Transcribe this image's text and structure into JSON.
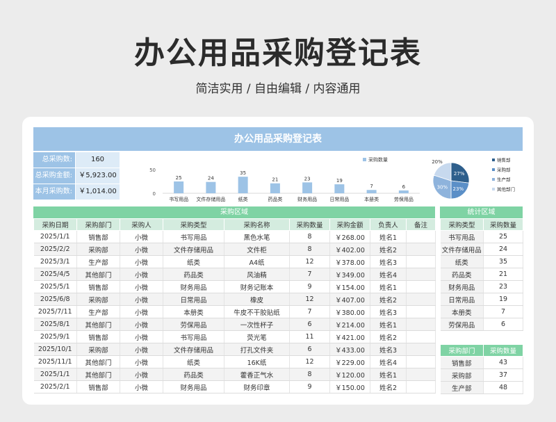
{
  "hero": {
    "title": "办公用品采购登记表",
    "subtitle": "简洁实用 / 自由编辑 / 内容通用"
  },
  "sheet": {
    "title": "办公用品采购登记表"
  },
  "kpis": [
    {
      "label": "总采购数:",
      "value": "160"
    },
    {
      "label": "总采购金额:",
      "value": "￥5,923.00"
    },
    {
      "label": "本月采购数:",
      "value": "￥1,014.00"
    }
  ],
  "chart_data": [
    {
      "type": "bar",
      "categories": [
        "书写用品",
        "文件存储用品",
        "纸类",
        "药品类",
        "财务用品",
        "日常用品",
        "本册类",
        "劳保用品"
      ],
      "values": [
        25,
        24,
        35,
        21,
        23,
        19,
        7,
        6
      ],
      "ylim": [
        0,
        50
      ],
      "yticks": [
        "50",
        "0"
      ],
      "legend": "采购数量",
      "legend_position": "top-right",
      "color": "#9dc3e6"
    },
    {
      "type": "pie",
      "categories": [
        "销售部",
        "采购部",
        "生产部",
        "其他部门"
      ],
      "values": [
        27,
        23,
        30,
        20
      ],
      "labels": [
        "27%",
        "23%",
        "30%",
        "20%"
      ],
      "colors": [
        "#2e5f8c",
        "#5b8fc7",
        "#8eb3dc",
        "#c7d9ee"
      ],
      "legend_position": "right"
    }
  ],
  "purchase": {
    "section_title": "采购区域",
    "headers": [
      "采购日期",
      "采购部门",
      "采购人",
      "采购类型",
      "采购名称",
      "采购数量",
      "采购金额",
      "负责人",
      "备注"
    ],
    "rows": [
      [
        "2025/1/1",
        "销售部",
        "小微",
        "书写用品",
        "黑色水笔",
        "8",
        "￥268.00",
        "姓名1",
        ""
      ],
      [
        "2025/2/2",
        "采购部",
        "小微",
        "文件存储用品",
        "文件柜",
        "8",
        "￥402.00",
        "姓名2",
        ""
      ],
      [
        "2025/3/1",
        "生产部",
        "小微",
        "纸类",
        "A4纸",
        "12",
        "￥378.00",
        "姓名3",
        ""
      ],
      [
        "2025/4/5",
        "其他部门",
        "小微",
        "药品类",
        "风油精",
        "7",
        "￥349.00",
        "姓名4",
        ""
      ],
      [
        "2025/5/1",
        "销售部",
        "小微",
        "财务用品",
        "财务记账本",
        "9",
        "￥154.00",
        "姓名1",
        ""
      ],
      [
        "2025/6/8",
        "采购部",
        "小微",
        "日常用品",
        "橡皮",
        "12",
        "￥407.00",
        "姓名2",
        ""
      ],
      [
        "2025/7/11",
        "生产部",
        "小微",
        "本册类",
        "牛皮不干胶贴纸",
        "7",
        "￥380.00",
        "姓名3",
        ""
      ],
      [
        "2025/8/1",
        "其他部门",
        "小微",
        "劳保用品",
        "一次性杯子",
        "6",
        "￥214.00",
        "姓名1",
        ""
      ],
      [
        "2025/9/1",
        "销售部",
        "小微",
        "书写用品",
        "荧光笔",
        "11",
        "￥421.00",
        "姓名2",
        ""
      ],
      [
        "2025/10/1",
        "采购部",
        "小微",
        "文件存储用品",
        "打孔文件夹",
        "6",
        "￥433.00",
        "姓名3",
        ""
      ],
      [
        "2025/11/1",
        "其他部门",
        "小微",
        "纸类",
        "16K纸",
        "12",
        "￥229.00",
        "姓名4",
        ""
      ],
      [
        "2025/1/1",
        "其他部门",
        "小微",
        "药品类",
        "藿香正气水",
        "8",
        "￥120.00",
        "姓名1",
        ""
      ],
      [
        "2025/2/1",
        "销售部",
        "小微",
        "财务用品",
        "财务印章",
        "9",
        "￥150.00",
        "姓名2",
        ""
      ]
    ]
  },
  "stats": {
    "section_title": "统计区域",
    "type_headers": [
      "采购类型",
      "采购数量"
    ],
    "type_rows": [
      [
        "书写用品",
        "25"
      ],
      [
        "文件存储用品",
        "24"
      ],
      [
        "纸类",
        "35"
      ],
      [
        "药品类",
        "21"
      ],
      [
        "财务用品",
        "23"
      ],
      [
        "日常用品",
        "19"
      ],
      [
        "本册类",
        "7"
      ],
      [
        "劳保用品",
        "6"
      ]
    ],
    "dept_headers": [
      "采购部门",
      "采购数量"
    ],
    "dept_rows": [
      [
        "销售部",
        "43"
      ],
      [
        "采购部",
        "37"
      ],
      [
        "生产部",
        "48"
      ]
    ]
  }
}
